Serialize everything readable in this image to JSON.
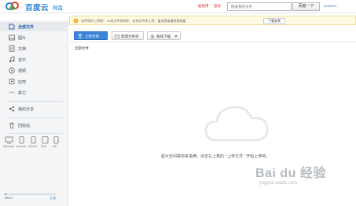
{
  "header": {
    "brand": "百度云",
    "brand_sub": "网盘",
    "link_vip": "超级用",
    "link_login": "登录",
    "search_placeholder": "搜索我的文件",
    "search_button": "百度一下",
    "user_id": "6258290..."
  },
  "sidebar": {
    "items": [
      {
        "label": "全部文件",
        "icon": "files-icon",
        "active": true
      },
      {
        "label": "图片",
        "icon": "image-icon"
      },
      {
        "label": "文档",
        "icon": "document-icon"
      },
      {
        "label": "音乐",
        "icon": "music-icon"
      },
      {
        "label": "视频",
        "icon": "video-icon"
      },
      {
        "label": "应用",
        "icon": "app-icon"
      },
      {
        "label": "其它",
        "icon": "more-icon"
      },
      {
        "label": "我的分享",
        "icon": "share-icon"
      },
      {
        "label": "回收站",
        "icon": "trash-icon"
      }
    ],
    "devices": [
      "Windows",
      "Android",
      "iPhone",
      "iPad",
      "WP"
    ],
    "quota_text": "0B/5G",
    "quota_fraction": 0.03,
    "expand_label": "扩容"
  },
  "notice": {
    "text": "文件同步上传啦！ 40次文件夹同步，支持文件夹上传，暂未登录请使用网盘",
    "button": "下载安装"
  },
  "toolbar": {
    "upload_label": "上传文件",
    "new_folder_label": "新建文件夹",
    "offline_download_label": "离线下载"
  },
  "breadcrumb": "全部文件",
  "empty_state": {
    "text": "超大空间等你来填满，点击左上角的 “上传文件” 开始上传吧。"
  },
  "watermark": {
    "main": "Bai du 经验",
    "url": "jingyan.baidu.com"
  },
  "colors": {
    "accent": "#3d85d8",
    "brand": "#2a7fd2",
    "sidebar_bg": "#f3f5f7",
    "notice_bg": "#fffbe3"
  }
}
